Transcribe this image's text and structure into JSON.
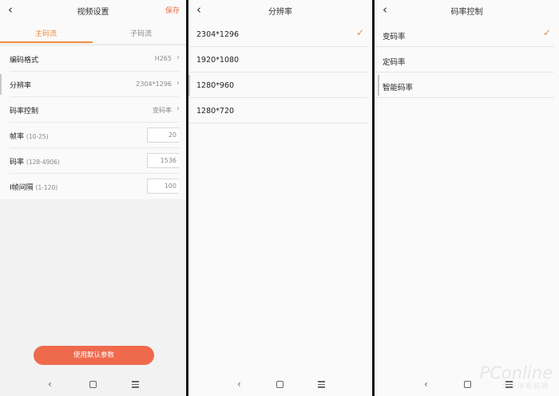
{
  "panel1": {
    "back_icon": "chevron-left-icon",
    "title": "视频设置",
    "save_label": "保存",
    "tabs": [
      {
        "label": "主码流"
      },
      {
        "label": "子码流"
      }
    ],
    "rows": [
      {
        "label": "编码格式",
        "value": "H265"
      },
      {
        "label": "分辨率",
        "value": "2304*1296"
      },
      {
        "label": "码率控制",
        "value": "变码率"
      }
    ],
    "inputs": [
      {
        "label": "帧率",
        "hint": "(10-25)",
        "value": "20"
      },
      {
        "label": "码率",
        "hint": "(128-4906)",
        "value": "1536"
      },
      {
        "label": "I帧间隔",
        "hint": "(1-120)",
        "value": "100"
      }
    ],
    "default_button": "使用默认参数"
  },
  "panel2": {
    "title": "分辨率",
    "options": [
      {
        "label": "2304*1296"
      },
      {
        "label": "1920*1080"
      },
      {
        "label": "1280*960"
      },
      {
        "label": "1280*720"
      }
    ],
    "selected": "2304*1296"
  },
  "panel3": {
    "title": "码率控制",
    "options": [
      {
        "label": "变码率"
      },
      {
        "label": "定码率"
      },
      {
        "label": "智能码率"
      }
    ],
    "selected": "变码率"
  },
  "nav": {
    "icons": [
      "back-triangle-icon",
      "home-square-icon",
      "menu-lines-icon"
    ]
  },
  "watermark": {
    "text": "PConline",
    "sub": "太平洋电脑网"
  },
  "colors": {
    "accent": "#f2883a",
    "button": "#ef6a4c",
    "save": "#f26b3a"
  }
}
